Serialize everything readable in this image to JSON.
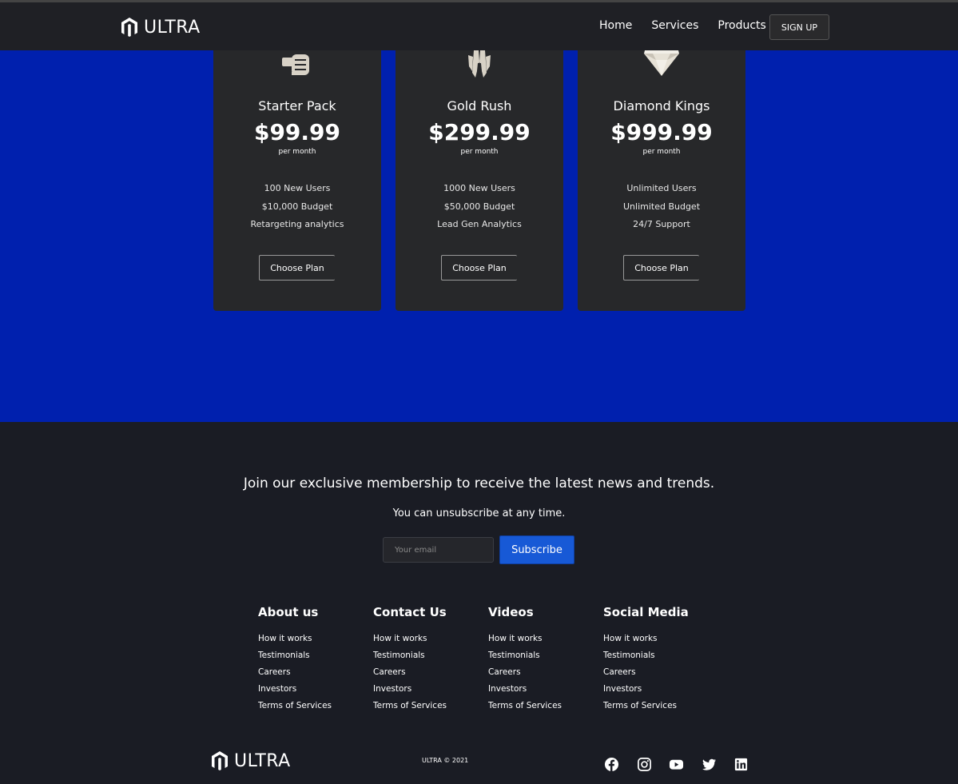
{
  "nav": {
    "brand": "ULTRA",
    "links": [
      "Home",
      "Services",
      "Products"
    ],
    "signup": "SIGN UP"
  },
  "plans": [
    {
      "name": "Starter Pack",
      "price": "$99.99",
      "period": "per month",
      "features": [
        "100 New Users",
        "$10,000 Budget",
        "Retargeting analytics"
      ],
      "button": "Choose Plan",
      "icon": "fist-icon"
    },
    {
      "name": "Gold Rush",
      "price": "$299.99",
      "period": "per month",
      "features": [
        "1000 New Users",
        "$50,000 Budget",
        "Lead Gen Analytics"
      ],
      "button": "Choose Plan",
      "icon": "gold-icon"
    },
    {
      "name": "Diamond Kings",
      "price": "$999.99",
      "period": "per month",
      "features": [
        "Unlimited Users",
        "Unlimited Budget",
        "24/7 Support"
      ],
      "button": "Choose Plan",
      "icon": "diamond-icon"
    }
  ],
  "newsletter": {
    "title": "Join our exclusive membership to receive the latest news and trends.",
    "subtitle": "You can unsubscribe at any time.",
    "email_placeholder": "Your email",
    "subscribe": "Subscribe"
  },
  "footer_columns": [
    {
      "title": "About us",
      "links": [
        "How it works",
        "Testimonials",
        "Careers",
        "Investors",
        "Terms of Services"
      ]
    },
    {
      "title": "Contact Us",
      "links": [
        "How it works",
        "Testimonials",
        "Careers",
        "Investors",
        "Terms of Services"
      ]
    },
    {
      "title": "Videos",
      "links": [
        "How it works",
        "Testimonials",
        "Careers",
        "Investors",
        "Terms of Services"
      ]
    },
    {
      "title": "Social Media",
      "links": [
        "How it works",
        "Testimonials",
        "Careers",
        "Investors",
        "Terms of Services"
      ]
    }
  ],
  "bottom": {
    "brand": "ULTRA",
    "copyright": "ULTRA © 2021",
    "socials": [
      "facebook-icon",
      "instagram-icon",
      "youtube-icon",
      "twitter-icon",
      "linkedin-icon"
    ]
  },
  "colors": {
    "pricing_bg": "#0020ae",
    "card_bg": "#27282a",
    "footer_bg": "#1a1c24",
    "accent": "#1759d6"
  }
}
